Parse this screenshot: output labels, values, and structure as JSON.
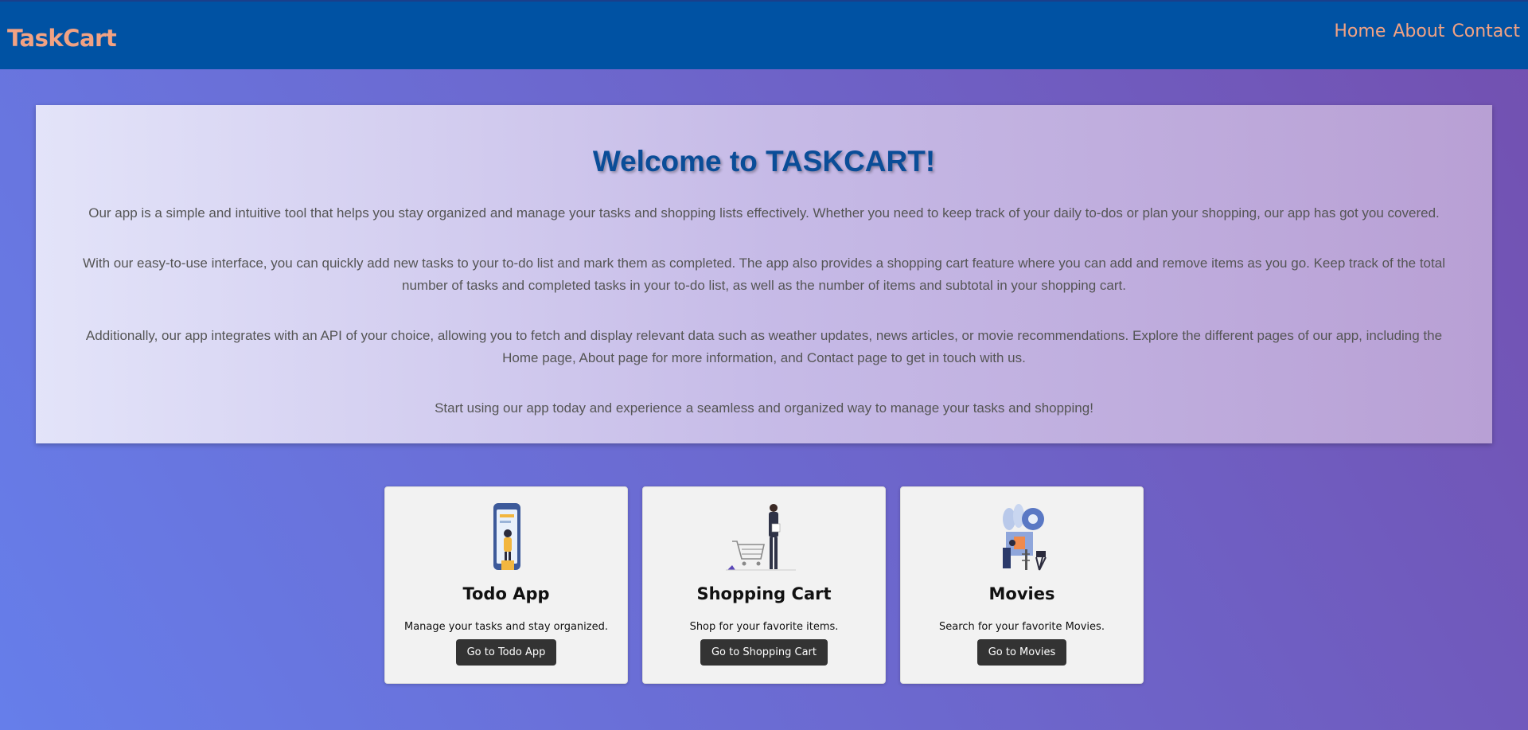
{
  "nav": {
    "brand": "TaskCart",
    "links": [
      "Home",
      "About",
      "Contact"
    ]
  },
  "welcome": {
    "title": "Welcome to TASKCART!",
    "paragraphs": [
      "Our app is a simple and intuitive tool that helps you stay organized and manage your tasks and shopping lists effectively. Whether you need to keep track of your daily to-dos or plan your shopping, our app has got you covered.",
      "With our easy-to-use interface, you can quickly add new tasks to your to-do list and mark them as completed. The app also provides a shopping cart feature where you can add and remove items as you go. Keep track of the total number of tasks and completed tasks in your to-do list, as well as the number of items and subtotal in your shopping cart.",
      "Additionally, our app integrates with an API of your choice, allowing you to fetch and display relevant data such as weather updates, news articles, or movie recommendations. Explore the different pages of our app, including the Home page, About page for more information, and Contact page to get in touch with us.",
      "Start using our app today and experience a seamless and organized way to manage your tasks and shopping!"
    ]
  },
  "cards": [
    {
      "illustration": "todo-illustration",
      "title": "Todo App",
      "description": "Manage your tasks and stay organized.",
      "button": "Go to Todo App"
    },
    {
      "illustration": "shopping-cart-illustration",
      "title": "Shopping Cart",
      "description": "Shop for your favorite items.",
      "button": "Go to Shopping Cart"
    },
    {
      "illustration": "movies-illustration",
      "title": "Movies",
      "description": "Search for your favorite Movies.",
      "button": "Go to Movies"
    }
  ],
  "colors": {
    "navbar": "#0052a3",
    "brand_accent": "#f2a283",
    "title": "#0a4d98",
    "button": "#333333",
    "background_start": "#667eea",
    "background_end": "#7350b0"
  }
}
